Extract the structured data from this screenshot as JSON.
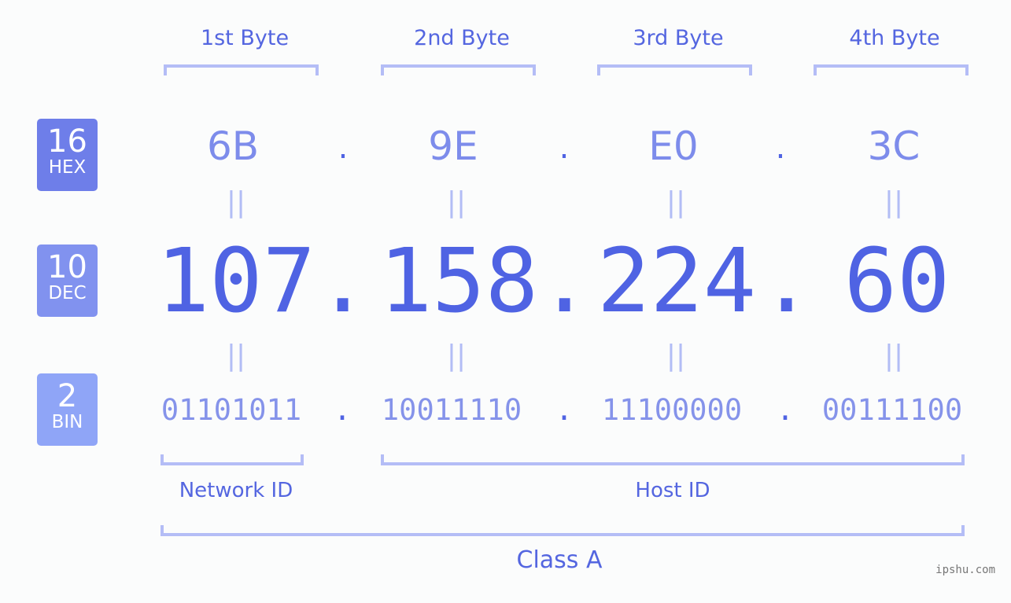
{
  "bytes": [
    {
      "label": "1st Byte",
      "hex": "6B",
      "dec": "107",
      "bin": "01101011"
    },
    {
      "label": "2nd Byte",
      "hex": "9E",
      "dec": "158",
      "bin": "10011110"
    },
    {
      "label": "3rd Byte",
      "hex": "E0",
      "dec": "224",
      "bin": "11100000"
    },
    {
      "label": "4th Byte",
      "hex": "3C",
      "dec": "60",
      "bin": "00111100"
    }
  ],
  "separator": ".",
  "equals": "||",
  "badges": {
    "hex": {
      "num": "16",
      "label": "HEX"
    },
    "dec": {
      "num": "10",
      "label": "DEC"
    },
    "bin": {
      "num": "2",
      "label": "BIN"
    }
  },
  "sections": {
    "network_id": "Network ID",
    "host_id": "Host ID",
    "class": "Class A"
  },
  "watermark": "ipshu.com",
  "colors": {
    "primary": "#4f63e3",
    "hex_badge": "#6e7ee9",
    "dec_badge": "#8192ef",
    "bin_badge": "#8fa5f7",
    "bracket": "#b4bdf6"
  }
}
